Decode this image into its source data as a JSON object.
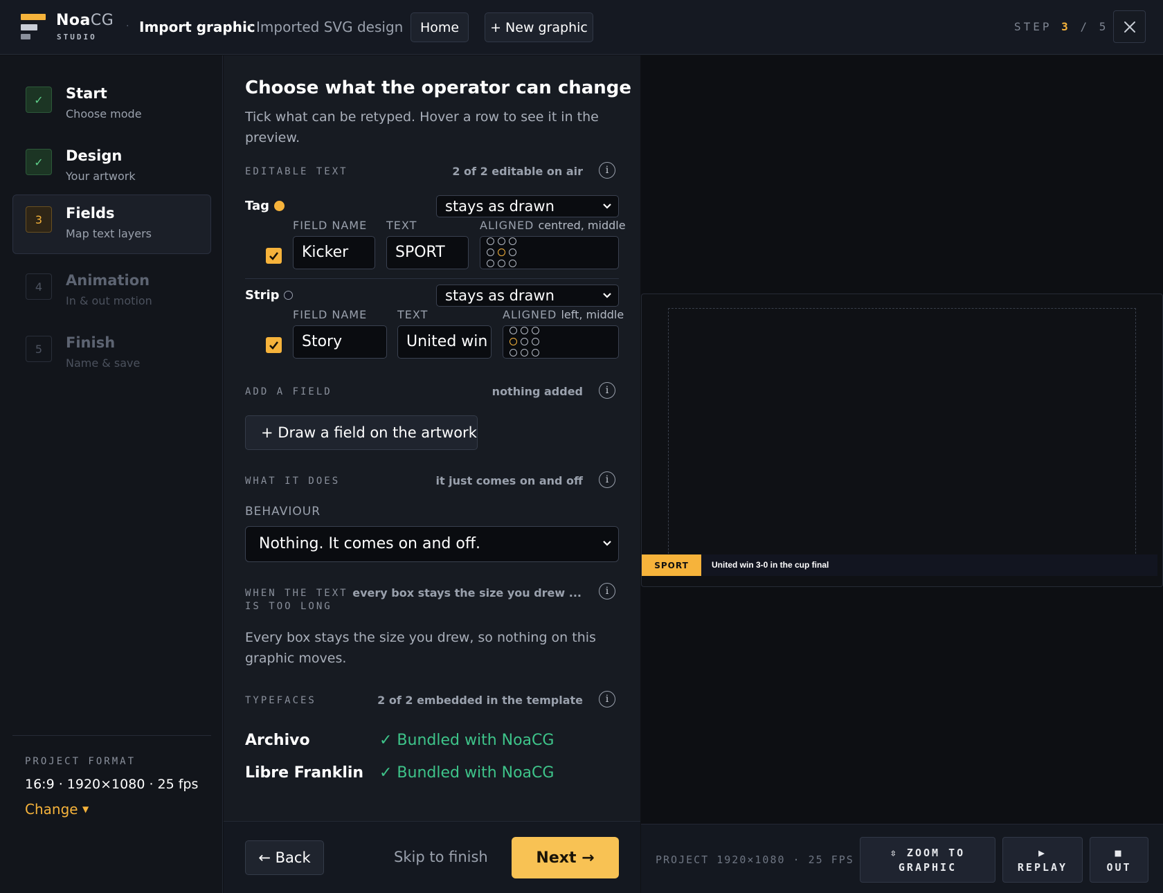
{
  "app": {
    "brand_bold": "Noa",
    "brand_light": "CG",
    "brand_sub": "STUDIO"
  },
  "header": {
    "title": "Import graphic",
    "subtitle": "Imported SVG design",
    "home_label": "Home",
    "new_graphic_label": "+ New graphic",
    "step_prefix": "STEP",
    "step_current": "3",
    "step_sep": "/",
    "step_total": "5"
  },
  "sidebar": {
    "items": [
      {
        "num": "✓",
        "title": "Start",
        "sub": "Choose mode",
        "state": "done"
      },
      {
        "num": "✓",
        "title": "Design",
        "sub": "Your artwork",
        "state": "done"
      },
      {
        "num": "3",
        "title": "Fields",
        "sub": "Map text layers",
        "state": "current"
      },
      {
        "num": "4",
        "title": "Animation",
        "sub": "In & out motion",
        "state": "todo"
      },
      {
        "num": "5",
        "title": "Finish",
        "sub": "Name & save",
        "state": "todo"
      }
    ],
    "project_format_label": "PROJECT FORMAT",
    "project_format_value": "16:9 · 1920×1080 · 25 fps",
    "change_label": "Change"
  },
  "main": {
    "heading": "Choose what the operator can change",
    "lead": "Tick what can be retyped. Hover a row to see it in the preview.",
    "editable": {
      "label": "EDITABLE TEXT",
      "meta": "2 of 2 editable on air",
      "rows": [
        {
          "layer": "Tag",
          "mode": "stays as drawn",
          "field_name_label": "FIELD NAME",
          "text_label": "TEXT",
          "aligned_label": "ALIGNED",
          "aligned_value": "centred, middle",
          "field_name": "Kicker",
          "text": "SPORT",
          "checked": true,
          "dot_color": "#f6b33b"
        },
        {
          "layer": "Strip",
          "mode": "stays as drawn",
          "field_name_label": "FIELD NAME",
          "text_label": "TEXT",
          "aligned_label": "ALIGNED",
          "aligned_value": "left, middle",
          "field_name": "Story",
          "text": "United win",
          "checked": true,
          "dot_color": "#121520"
        }
      ]
    },
    "add_field": {
      "label": "ADD A FIELD",
      "meta": "nothing added",
      "button": "+  Draw a field on the artwork"
    },
    "what_it_does": {
      "label": "WHAT IT DOES",
      "meta": "it just comes on and off",
      "behaviour_label": "BEHAVIOUR",
      "behaviour_value": "Nothing. It comes on and off."
    },
    "too_long": {
      "label_line1": "WHEN THE TEXT",
      "label_line2": "IS TOO LONG",
      "meta": "every box stays the size you drew ...",
      "text": "Every box stays the size you drew, so nothing on this graphic moves."
    },
    "typefaces": {
      "label": "TYPEFACES",
      "meta": "2 of 2 embedded in the template",
      "fonts": [
        {
          "name": "Archivo",
          "status": "✓ Bundled with NoaCG"
        },
        {
          "name": "Libre Franklin",
          "status": "✓ Bundled with NoaCG"
        }
      ]
    },
    "footer": {
      "back": "← Back",
      "skip": "Skip to finish",
      "next": "Next →"
    }
  },
  "preview": {
    "lower_third": {
      "tag": "SPORT",
      "text": "United win 3-0 in the cup final"
    },
    "footer_label": "PROJECT 1920×1080 · 25 FPS",
    "zoom_line1": "⇳ ZOOM TO",
    "zoom_line2": "GRAPHIC",
    "replay_icon": "▶",
    "replay_label": "REPLAY",
    "out_icon": "■",
    "out_label": "OUT"
  },
  "colors": {
    "accent": "#f6b33b",
    "success": "#3ec48a",
    "background": "#0f1115"
  }
}
